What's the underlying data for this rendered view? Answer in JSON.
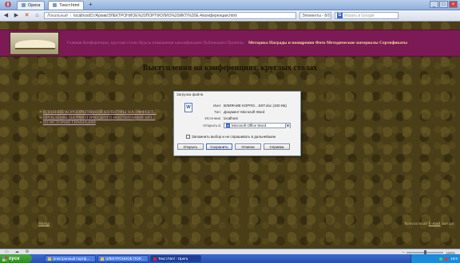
{
  "browser": {
    "tabs": [
      {
        "label": "Opera"
      },
      {
        "label": "Текст.html"
      }
    ],
    "address": {
      "local_badge": "Локальный",
      "url": "localhost/D:/Архив/ЭЛЕКТРОНИОЕ%20ПОРТФОЛИО%20ИКТ/%20Е.4/конференции.html"
    },
    "speed_dial": "Элементы - 8/0",
    "search_placeholder": "Искать в Google"
  },
  "page": {
    "header_nav": {
      "muted": "Главная   Конференции, круглые столы   Курсы повышения квалификации   Публикации   Проекты",
      "bright": "Методика   Награды и поощрения   Фото   Методические материалы   Сертификаты"
    },
    "title": "Выступления на конференциях, круглых столах",
    "links": [
      "ВЛИЯНИЕ КОРПОРАТИВНОЙ КУЛЬТУРЫ НА ЭФФЕКТ...",
      "ПРОБЛЕМЫ ПАТРИОТИЧЕСКОГО ВОСПИТАНИЯ МО...",
      "ИЗ ИСТОРИИ ГИМНАЗИИ"
    ],
    "footer_left": "Назад",
    "footer_right_prefix": "Контактный",
    "footer_right_email": "E-mail",
    "footer_right_suffix": "автора"
  },
  "dialog": {
    "title": "Загрузка файла",
    "fields": [
      {
        "label": "Имя:",
        "value": "ВЛИЯНИЕ КОРПО....ЕКТ.doc (100 КБ)"
      },
      {
        "label": "Тип:",
        "value": "Документ Microsoft Word"
      },
      {
        "label": "Источник:",
        "value": "localhost"
      }
    ],
    "open_with_label": "Открыть в:",
    "open_with_value": "Microsoft Office Word",
    "remember_label": "Запомнить выбор и не спрашивать в дальнейшем",
    "buttons": {
      "open": "Открыть",
      "save": "Сохранить",
      "cancel": "Отмена",
      "help": "Справка"
    }
  },
  "statusbar": {
    "zoom": "100%"
  },
  "taskbar": {
    "start": "пуск",
    "tasks": [
      {
        "label": "Электронный портф..."
      },
      {
        "label": "ЭЛЕКТРОННОЕ ПОР..."
      },
      {
        "label": "Текст.html - Opera"
      }
    ],
    "clock": "19:0"
  }
}
